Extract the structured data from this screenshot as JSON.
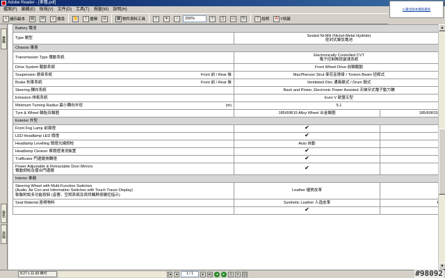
{
  "window": {
    "title": "Adobe Reader - [車種.pdf]",
    "controls": [
      "_",
      "□",
      "x"
    ]
  },
  "menu": [
    "檔案(F)",
    "編輯(E)",
    "檢視(V)",
    "文件(D)",
    "工具(T)",
    "視窗(W)",
    "說明(H)"
  ],
  "promo": {
    "text": "以最佳版本獲取最新"
  },
  "toolbar": {
    "save_label": "儲存副本",
    "print_label": "",
    "search_label": "搜尋",
    "select_label": "選擇",
    "sign_label": "快照工具",
    "attach_label": "物件資料工具",
    "zoom_value": "200%",
    "help_label": "說明",
    "adobe_label": "Y特報"
  },
  "leftnav": {
    "tab1": "書籤",
    "tab2": "簽名",
    "tab3": "頁面"
  },
  "spec_rows": [
    {
      "type": "section",
      "label": "Battery 電池"
    },
    {
      "type": "row",
      "label": "Type 類型",
      "value_lines": [
        "Sealed Ni-MH (Nickel-Metal Hydride)",
        "密封式鎳氫電池"
      ]
    },
    {
      "type": "section",
      "label": "Chassis 車身"
    },
    {
      "type": "row",
      "label": "Transmission Type 傳動系統",
      "value_lines": [
        "Electronically Controlled CVT",
        "電子控制無段變速系統"
      ]
    },
    {
      "type": "row",
      "label": "Drive System 驅動系統",
      "value_lines": [
        "Front Wheel Drive 前輪驅動"
      ]
    },
    {
      "type": "row",
      "label": "Suspension 懸掛系統",
      "sub": "Front 前 / Rear 後",
      "value_lines": [
        "MacPherson Strut 麥花臣懸掛 / Torsion Beam 扭桿式"
      ]
    },
    {
      "type": "row",
      "label": "Brake 剎車系統",
      "sub": "Front 前 / Rear 後",
      "value_lines": [
        "Ventilated Disc 通風碟式 / Drum 鼓式"
      ]
    },
    {
      "type": "row",
      "label": "Steering 轉向系統",
      "value_lines": [
        "Rack and Pinion, Electronic Power Assisted 天梯牙式電子動力輔"
      ]
    },
    {
      "type": "row",
      "label": "Emission 排氣系統",
      "value_lines": [
        "Euro V 歐盟五型"
      ]
    },
    {
      "type": "row",
      "label": "Minimum Turning Radius 最小轉向半徑",
      "sub": "(m)",
      "value_lines": [
        "5.1"
      ]
    },
    {
      "type": "split",
      "label": "Tyre & Wheel 輪胎及輪圈",
      "value_a": "185/60R15  Alloy Wheel 合金輪圈",
      "value_b": "185/60R15 F"
    },
    {
      "type": "section",
      "label": "Exterior 外型"
    },
    {
      "type": "split",
      "label": "Front Fog Lamp 前霧燈",
      "check_a": "✔",
      "value_b": ""
    },
    {
      "type": "split",
      "label": "LED Headlamp LED 頭燈",
      "check_a": "✔",
      "value_b": ""
    },
    {
      "type": "split",
      "label": "Headlamp Levelling 頭燈光線調校",
      "value_a": "Auto 自動",
      "value_b": ""
    },
    {
      "type": "split",
      "label": "Headlamp Cleaner 車頭燈清洗裝置",
      "check_a": "✔",
      "value_b": ""
    },
    {
      "type": "split",
      "label": "Trafficator 門邊鏡側轉燈",
      "check_a": "✔",
      "value_b": ""
    },
    {
      "type": "split2",
      "label_lines": [
        "Power Adjustable & Retractable Door Mirrors",
        "電動調校及摺合門邊鏡"
      ],
      "check_a": "✔",
      "value_b": ""
    },
    {
      "type": "section",
      "label": "Interior 車廂"
    },
    {
      "type": "split3",
      "label_lines": [
        "Steering Wheel with Multi-Function Switches",
        "(Audio, Air Con and Information Switches with Touch Tracer Display)",
        "軟聯附設多功能按鈕 (音響、空調系統及資訊觸屏按鍵控指示)"
      ],
      "value_a": "Leather 優質皮革",
      "value_b": ""
    },
    {
      "type": "split",
      "label": "Seat Material 座椅物料",
      "value_a": "Synthetic Leather 人造皮革",
      "value_b": "Fa"
    },
    {
      "type": "split",
      "label": "",
      "check_a": "✔",
      "value_b": ""
    }
  ],
  "status": {
    "page_size": "8.27 x 11.69 英吋",
    "page_indicator": "1 / 1"
  },
  "watermark": "#98092"
}
